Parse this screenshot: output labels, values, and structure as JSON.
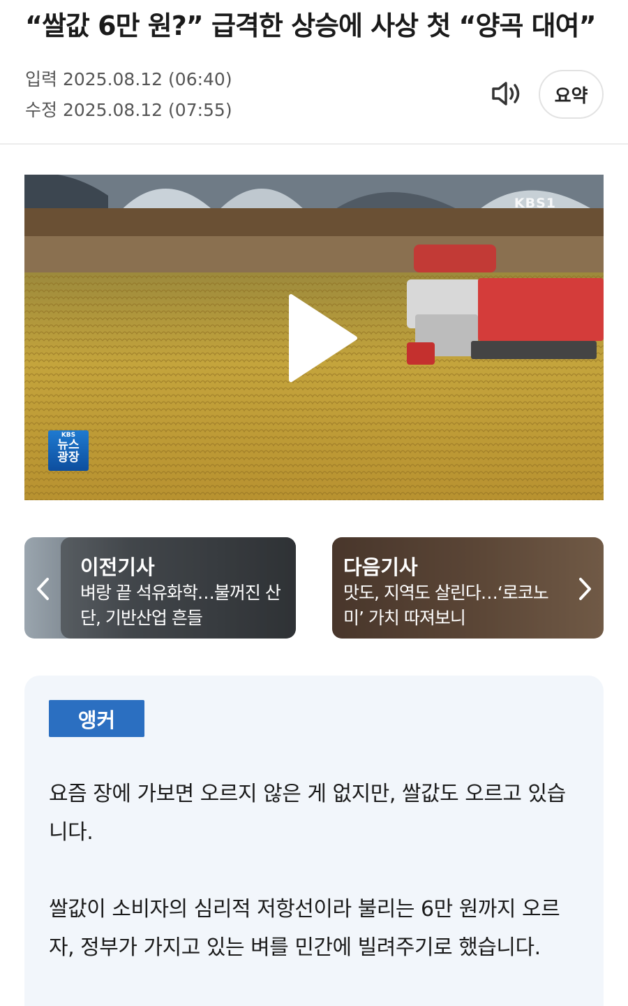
{
  "article": {
    "headline": "“쌀값 6만 원?” 급격한 상승에 사상 첫 “양곡 대여”",
    "published": "입력 2025.08.12 (06:40)",
    "modified": "수정 2025.08.12 (07:55)",
    "speaker_icon": "speaker-icon",
    "summary_label": "요약"
  },
  "video": {
    "watermark": "KBS1",
    "badge_small": "KBS",
    "badge_line1": "뉴스",
    "badge_line2": "광장",
    "play_icon": "play-icon"
  },
  "navigation": {
    "prev_label": "이전기사",
    "prev_title": "벼랑 끝 석유화학…불꺼진 산단, 기반산업 흔들",
    "next_label": "다음기사",
    "next_title": "맛도, 지역도 살린다…‘로코노미’ 가치 따져보니"
  },
  "body": {
    "tag": "앵커",
    "paragraph1": "요즘 장에 가보면 오르지 않은 게 없지만, 쌀값도 오르고 있습니다.",
    "paragraph2": "쌀값이 소비자의 심리적 저항선이라 불리는 6만 원까지 오르자, 정부가 가지고 있는 벼를 민간에 빌려주기로 했습니다."
  }
}
